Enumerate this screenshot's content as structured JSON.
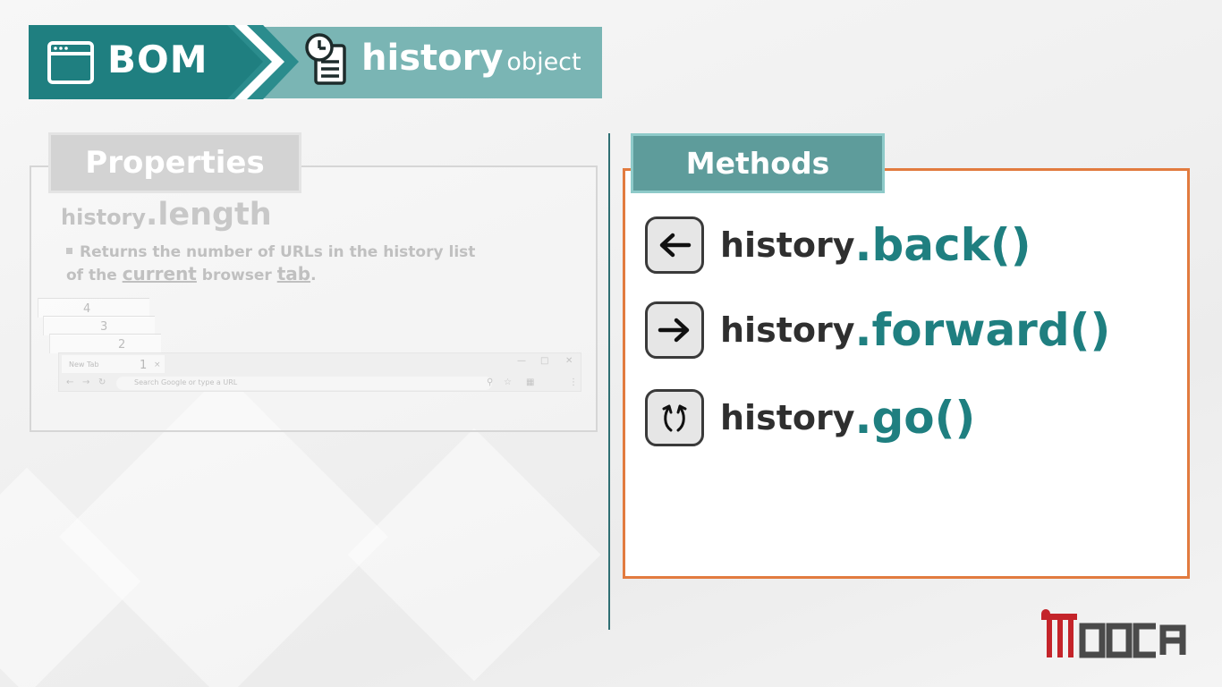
{
  "header": {
    "section_label": "BOM",
    "object_name": "history",
    "object_suffix": "object",
    "icons": [
      "browser-window-icon",
      "clock-document-icon"
    ],
    "colors": {
      "dark_teal": "#1f7f80",
      "light_teal": "#7ab5b4"
    }
  },
  "properties": {
    "heading": "Properties",
    "object": "history",
    "dot": ".",
    "property": "length",
    "description_start": "Returns the number of URLs in the history list of the",
    "description_word_current": "current",
    "description_mid": "browser",
    "description_word_tab": "tab",
    "description_end": ".",
    "stack_numbers": [
      "4",
      "3",
      "2",
      "1"
    ],
    "browser_mock": {
      "tab_title": "New Tab",
      "tab_close": "×",
      "address_placeholder": "Search Google or type a URL"
    }
  },
  "methods": {
    "heading": "Methods",
    "accent_color": "#e27b3f",
    "items": [
      {
        "object": "history",
        "dot": ".",
        "name": "back()",
        "icon": "back-arrow-icon"
      },
      {
        "object": "history",
        "dot": ".",
        "name": "forward()",
        "icon": "forward-arrow-icon"
      },
      {
        "object": "history",
        "dot": ".",
        "name": "go()",
        "icon": "go-curved-arrows-icon"
      }
    ]
  },
  "logo": {
    "brand": "MOOCA"
  }
}
